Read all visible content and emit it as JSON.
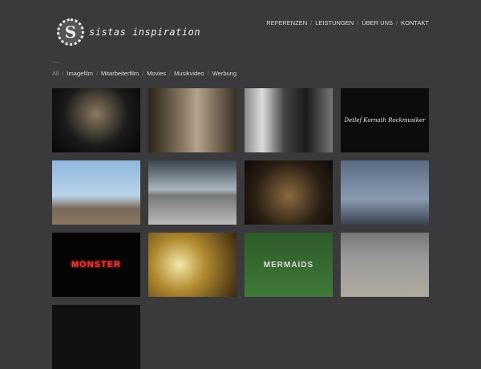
{
  "logo": {
    "text": "sistas inspiration",
    "seal": "S"
  },
  "nav": [
    "REFERENZEN",
    "LEISTUNGEN",
    "ÜBER UNS",
    "KONTAKT"
  ],
  "filters": {
    "all": "All",
    "items": [
      "Imagefilm",
      "Mitarbeiterfilm",
      "Movies",
      "Musikvideo",
      "Werbung"
    ]
  },
  "thumbnails": [
    {
      "caption": ""
    },
    {
      "caption": ""
    },
    {
      "caption": ""
    },
    {
      "caption": "Detlef Kornath Rockmusiker"
    },
    {
      "caption": ""
    },
    {
      "caption": ""
    },
    {
      "caption": ""
    },
    {
      "caption": ""
    },
    {
      "caption": "MONSTER"
    },
    {
      "caption": ""
    },
    {
      "caption": "MERMAIDS"
    },
    {
      "caption": ""
    },
    {
      "caption": ""
    }
  ]
}
